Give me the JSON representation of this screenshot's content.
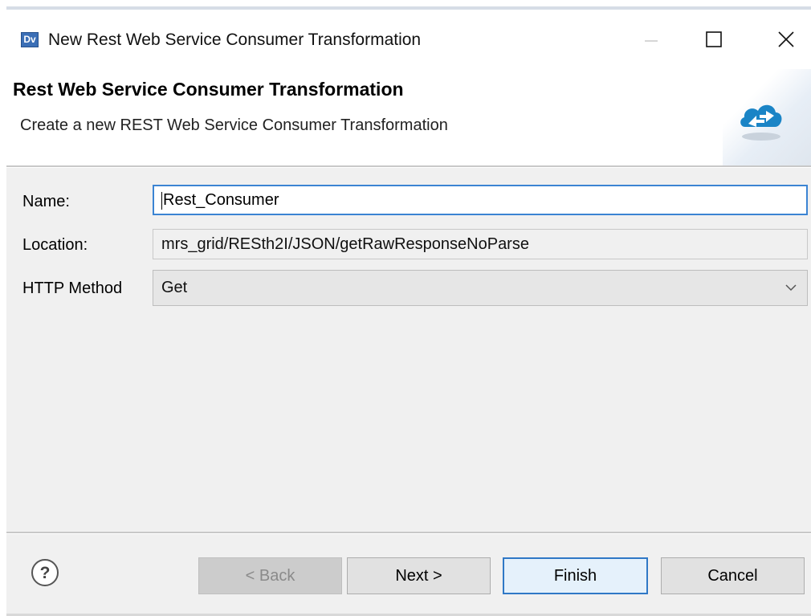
{
  "window": {
    "app_icon_text": "Dv",
    "title": "New Rest Web Service Consumer Transformation",
    "controls": {
      "minimize": "minimize",
      "maximize": "maximize",
      "close": "close"
    }
  },
  "header": {
    "title": "Rest Web Service Consumer Transformation",
    "description": "Create a new REST Web Service Consumer Transformation",
    "icon": "cloud-arrows-icon"
  },
  "form": {
    "name": {
      "label": "Name:",
      "value": "Rest_Consumer"
    },
    "location": {
      "label": "Location:",
      "value": "mrs_grid/RESth2I/JSON/getRawResponseNoParse"
    },
    "http_method": {
      "label": "HTTP Method",
      "value": "Get"
    }
  },
  "buttons": {
    "help": "?",
    "back": "< Back",
    "next": "Next >",
    "finish": "Finish",
    "cancel": "Cancel"
  },
  "colors": {
    "focus_border": "#3b84d3",
    "accent_icon": "#1a84c6",
    "dialog_bg": "#f0f0f0"
  }
}
